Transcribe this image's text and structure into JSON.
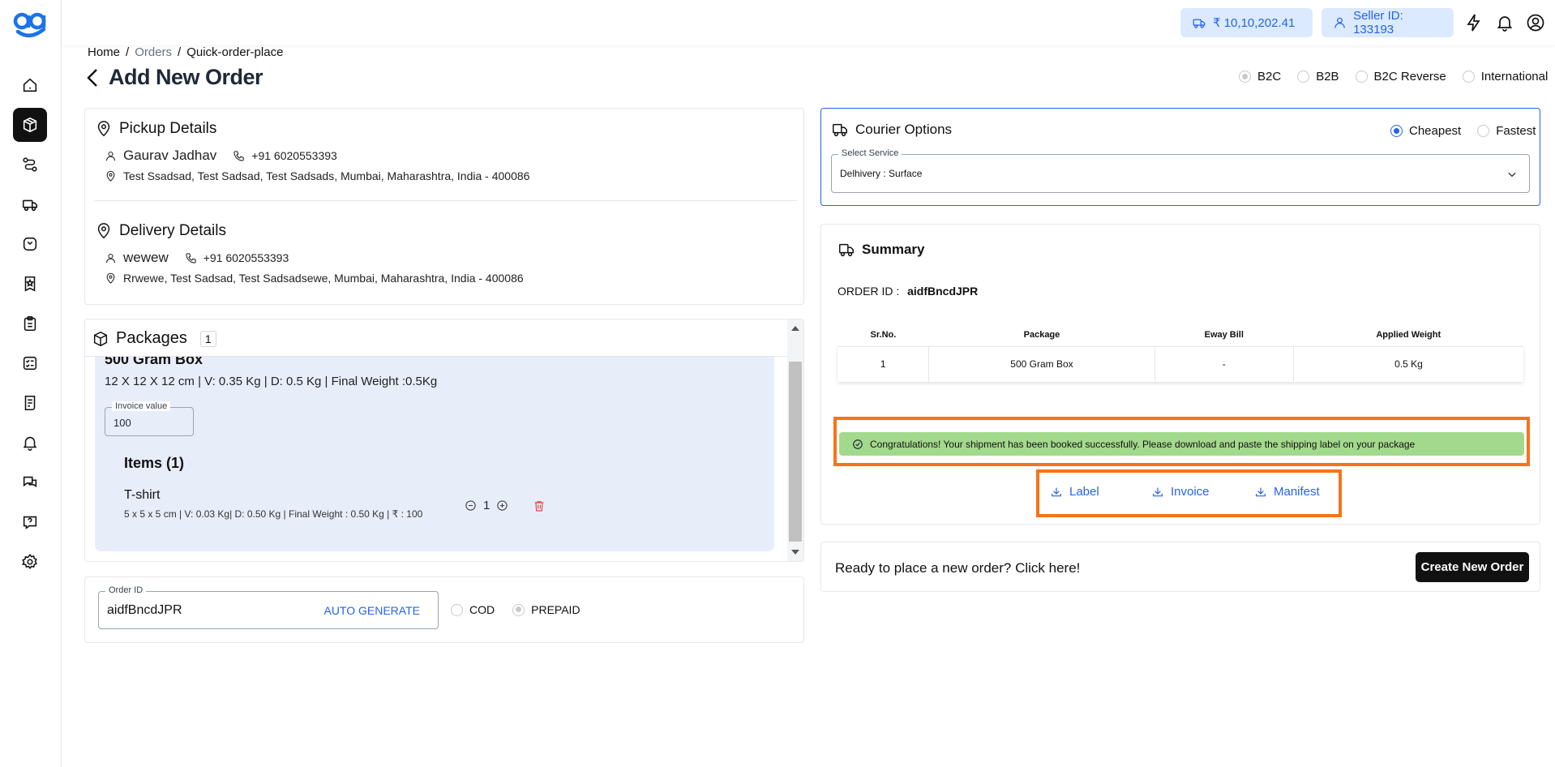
{
  "topbar": {
    "wallet": "₹ 10,10,202.41",
    "seller": "Seller ID: 133193"
  },
  "breadcrumb": {
    "home": "Home",
    "orders": "Orders",
    "current": "Quick-order-place"
  },
  "page_title": "Add New Order",
  "order_types": [
    "B2C",
    "B2B",
    "B2C Reverse",
    "International"
  ],
  "pickup": {
    "heading": "Pickup Details",
    "name": "Gaurav Jadhav",
    "phone": "+91 6020553393",
    "address": "Test Ssadsad, Test Sadsad, Test Sadsads, Mumbai, Maharashtra, India - 400086"
  },
  "delivery": {
    "heading": "Delivery Details",
    "name": "wewew",
    "phone": "+91 6020553393",
    "address": "Rrwewe, Test Sadsad, Test Sadsadsewe, Mumbai, Maharashtra, India - 400086"
  },
  "packages": {
    "heading": "Packages",
    "count": "1",
    "box_name": "500 Gram Box",
    "dims": "12 X 12 X 12 cm | V: 0.35 Kg | D: 0.5 Kg | Final Weight :0.5Kg",
    "invoice_label": "Invoice value",
    "invoice_value": "100",
    "items_heading": "Items (1)",
    "item_name": "T-shirt",
    "item_details": "5 x 5 x 5 cm | V: 0.03 Kg| D: 0.50 Kg | Final Weight : 0.50 Kg | ₹ : 100",
    "item_qty": "1"
  },
  "order": {
    "label": "Order ID",
    "value": "aidfBncdJPR",
    "auto_generate": "AUTO GENERATE",
    "cod": "COD",
    "prepaid": "PREPAID"
  },
  "courier": {
    "heading": "Courier Options",
    "cheapest": "Cheapest",
    "fastest": "Fastest",
    "select_label": "Select Service",
    "select_value": "Delhivery : Surface"
  },
  "summary": {
    "heading": "Summary",
    "order_id_label": "ORDER ID :",
    "order_id_value": "aidfBncdJPR",
    "columns": [
      "Sr.No.",
      "Package",
      "Eway Bill",
      "Applied Weight"
    ],
    "row": [
      "1",
      "500 Gram Box",
      "-",
      "0.5 Kg"
    ],
    "success": "Congratulations! Your shipment has been booked successfully. Please download and paste the shipping label on your package",
    "label_btn": "Label",
    "invoice_btn": "Invoice",
    "manifest_btn": "Manifest"
  },
  "new_order": {
    "prompt": "Ready to place a new order? Click here!",
    "button": "Create New Order"
  },
  "colors": {
    "accent": "#2563eb",
    "highlight": "#f97316",
    "success_bg": "#a3d98c",
    "package_bg": "#e8edfa",
    "dark": "#111111"
  }
}
